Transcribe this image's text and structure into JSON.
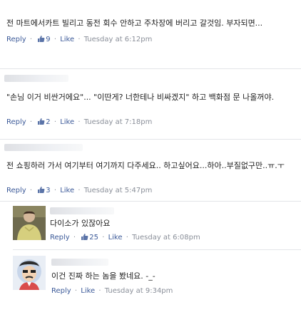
{
  "comments": [
    {
      "text": "전 마트에서카트 빌리고 동전 회수 안하고 주차장에 버리고 갈것임. 부자되면...",
      "reply_label": "Reply",
      "like_count": "9",
      "like_label": "Like",
      "timestamp": "Tuesday at 6:12pm"
    },
    {
      "text": "\"손님 이거 비싼거에요\"... \"이딴게? 너한테나 비싸겠지\" 하고 백화점 문 나올꺼야.",
      "reply_label": "Reply",
      "like_count": "2",
      "like_label": "Like",
      "timestamp": "Tuesday at 7:18pm"
    },
    {
      "text": "전 쇼핑하러 가서 여기부터 여기까지 다주세요.. 하고싶어요...하아..부질없구만..ㅠ.ㅜ",
      "reply_label": "Reply",
      "like_count": "3",
      "like_label": "Like",
      "timestamp": "Tuesday at 5:47pm"
    },
    {
      "text": "다이소가 있잖아요",
      "reply_label": "Reply",
      "like_count": "25",
      "like_label": "Like",
      "timestamp": "Tuesday at 6:08pm"
    },
    {
      "text": "이건 진짜 하는 놈을 봤네요. -_-",
      "reply_label": "Reply",
      "like_label": "Like",
      "timestamp": "Tuesday at 9:34pm"
    }
  ],
  "separator": "·",
  "colors": {
    "link": "#3b5998",
    "meta": "#8a8f99",
    "divider": "#e3e5e8"
  }
}
